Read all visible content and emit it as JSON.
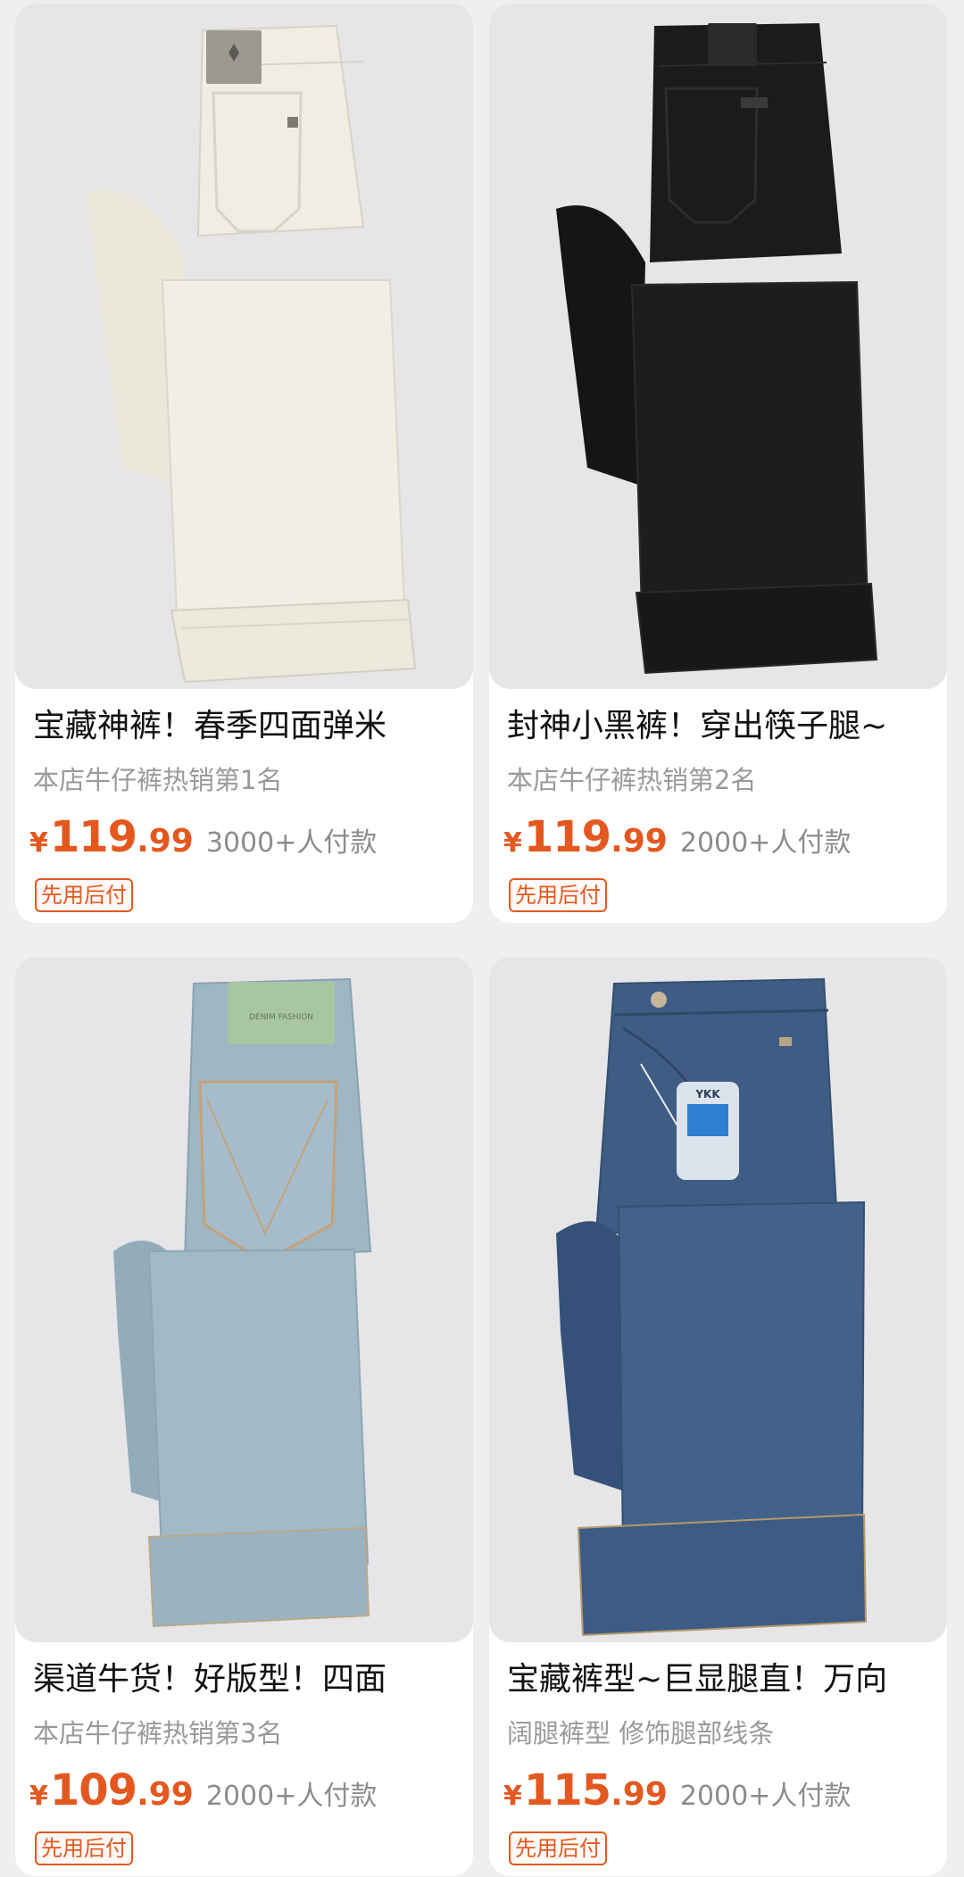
{
  "products": [
    {
      "title": "宝藏神裤！春季四面弹米",
      "subtitle": "本店牛仔裤热销第1名",
      "currency": "¥",
      "price_int": "119",
      "price_dec": ".99",
      "sales": "3000+人付款",
      "tag": "先用后付",
      "jean_color": "#f1ede2"
    },
    {
      "title": "封神小黑裤！穿出筷子腿~",
      "subtitle": "本店牛仔裤热销第2名",
      "currency": "¥",
      "price_int": "119",
      "price_dec": ".99",
      "sales": "2000+人付款",
      "tag": "先用后付",
      "jean_color": "#1a1a1b"
    },
    {
      "title": "渠道牛货！好版型！四面",
      "subtitle": "本店牛仔裤热销第3名",
      "currency": "¥",
      "price_int": "109",
      "price_dec": ".99",
      "sales": "2000+人付款",
      "tag": "先用后付",
      "jean_color": "#98b2c0"
    },
    {
      "title": "宝藏裤型~巨显腿直！万向",
      "subtitle": "阔腿裤型 修饰腿部线条",
      "currency": "¥",
      "price_int": "115",
      "price_dec": ".99",
      "sales": "2000+人付款",
      "tag": "先用后付",
      "jean_color": "#3c5a80"
    }
  ],
  "images": {
    "card3_patch_text": "DENIM FASHION",
    "card4_hangtag_text": "YKK"
  }
}
